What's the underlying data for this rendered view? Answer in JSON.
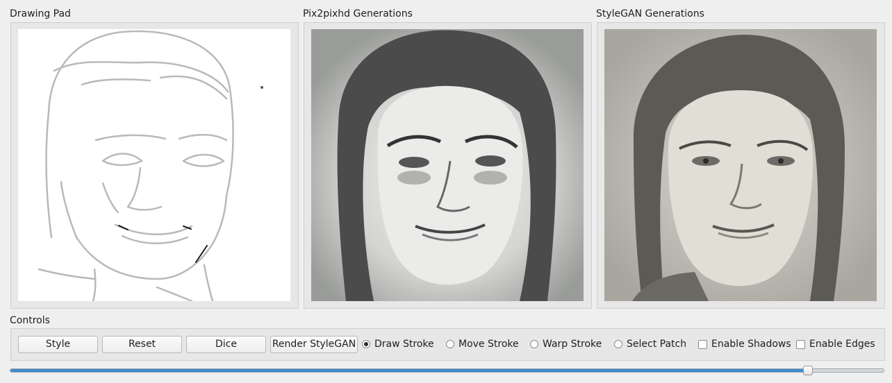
{
  "panels": {
    "drawing_pad": {
      "title": "Drawing Pad"
    },
    "pix2pixhd": {
      "title": "Pix2pixhd Generations"
    },
    "stylegan": {
      "title": "StyleGAN Generations"
    }
  },
  "controls": {
    "title": "Controls",
    "buttons": {
      "style": "Style",
      "reset": "Reset",
      "dice": "Dice",
      "render_stylegan": "Render StyleGAN"
    },
    "modes": [
      {
        "label": "Draw Stroke",
        "checked": true
      },
      {
        "label": "Move Stroke",
        "checked": false
      },
      {
        "label": "Warp Stroke",
        "checked": false
      },
      {
        "label": "Select Patch",
        "checked": false
      }
    ],
    "checkboxes": [
      {
        "label": "Enable Shadows",
        "checked": false
      },
      {
        "label": "Enable Edges",
        "checked": false
      }
    ],
    "slider": {
      "fraction": 0.913
    }
  },
  "colors": {
    "slider_fill": "#3f8ccf",
    "stroke_dark": "#1a1a1a"
  }
}
